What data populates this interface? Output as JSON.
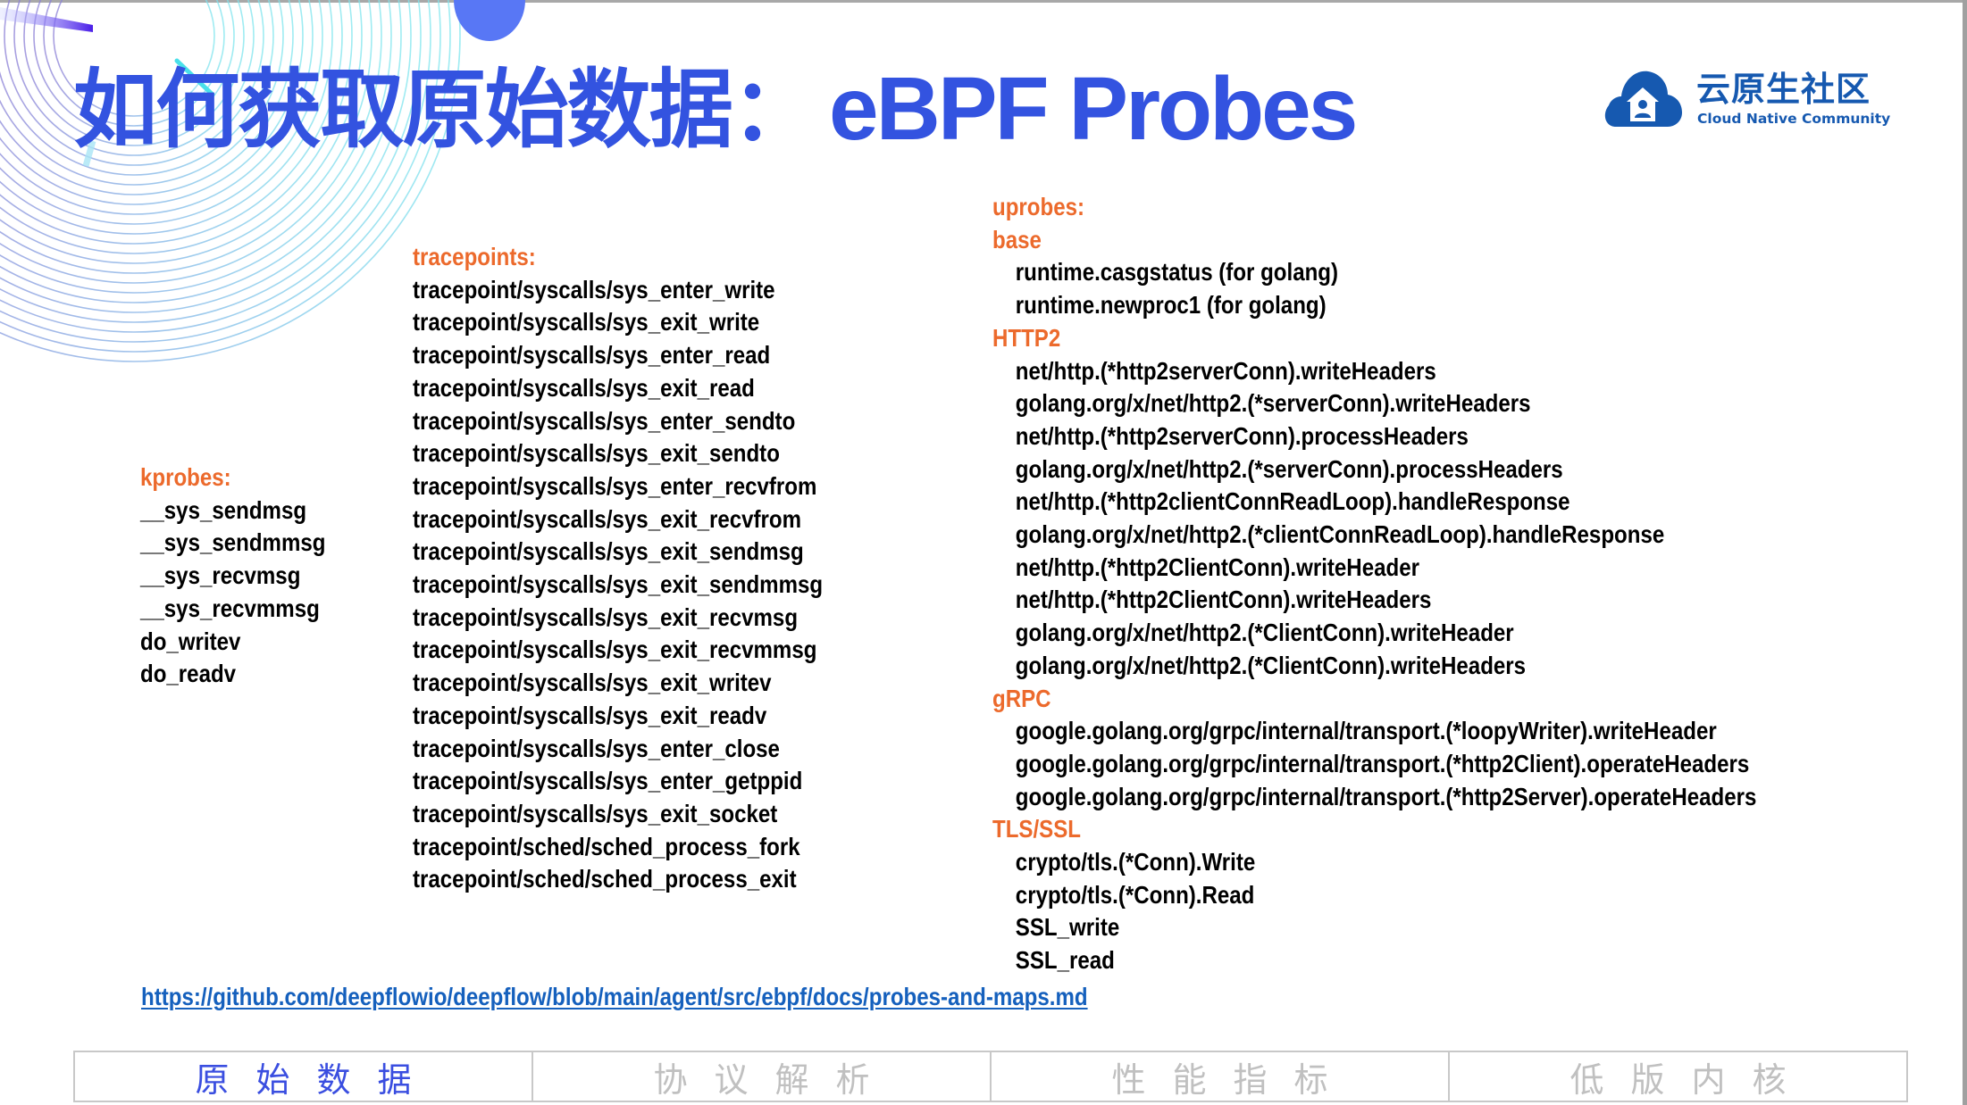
{
  "slide": {
    "title_cn": "如何获取原始数据：",
    "title_en": "eBPF Probes",
    "accent_color": "#3353e0",
    "header_color": "#ec6a2c"
  },
  "logo": {
    "name_cn": "云原生社区",
    "name_en": "Cloud Native Community",
    "icon": "cloud-house-icon",
    "color": "#1659b0"
  },
  "kprobes": {
    "header": "kprobes:",
    "items": [
      "__sys_sendmsg",
      "__sys_sendmmsg",
      "__sys_recvmsg",
      "__sys_recvmmsg",
      "do_writev",
      "do_readv"
    ]
  },
  "tracepoints": {
    "header": "tracepoints:",
    "items": [
      "tracepoint/syscalls/sys_enter_write",
      "tracepoint/syscalls/sys_exit_write",
      "tracepoint/syscalls/sys_enter_read",
      "tracepoint/syscalls/sys_exit_read",
      "tracepoint/syscalls/sys_enter_sendto",
      "tracepoint/syscalls/sys_exit_sendto",
      "tracepoint/syscalls/sys_enter_recvfrom",
      "tracepoint/syscalls/sys_exit_recvfrom",
      "tracepoint/syscalls/sys_exit_sendmsg",
      "tracepoint/syscalls/sys_exit_sendmmsg",
      "tracepoint/syscalls/sys_exit_recvmsg",
      "tracepoint/syscalls/sys_exit_recvmmsg",
      "tracepoint/syscalls/sys_exit_writev",
      "tracepoint/syscalls/sys_exit_readv",
      "tracepoint/syscalls/sys_enter_close",
      "tracepoint/syscalls/sys_enter_getppid",
      "tracepoint/syscalls/sys_exit_socket",
      "tracepoint/sched/sched_process_fork",
      "tracepoint/sched/sched_process_exit"
    ]
  },
  "uprobes": {
    "header": "uprobes:",
    "groups": [
      {
        "name": "base",
        "items": [
          "runtime.casgstatus (for golang)",
          "runtime.newproc1 (for golang)"
        ]
      },
      {
        "name": "HTTP2",
        "items": [
          "net/http.(*http2serverConn).writeHeaders",
          "golang.org/x/net/http2.(*serverConn).writeHeaders",
          "net/http.(*http2serverConn).processHeaders",
          "golang.org/x/net/http2.(*serverConn).processHeaders",
          "net/http.(*http2clientConnReadLoop).handleResponse",
          "golang.org/x/net/http2.(*clientConnReadLoop).handleResponse",
          "net/http.(*http2ClientConn).writeHeader",
          "net/http.(*http2ClientConn).writeHeaders",
          "golang.org/x/net/http2.(*ClientConn).writeHeader",
          "golang.org/x/net/http2.(*ClientConn).writeHeaders"
        ]
      },
      {
        "name": "gRPC",
        "items": [
          "google.golang.org/grpc/internal/transport.(*loopyWriter).writeHeader",
          "google.golang.org/grpc/internal/transport.(*http2Client).operateHeaders",
          "google.golang.org/grpc/internal/transport.(*http2Server).operateHeaders"
        ]
      },
      {
        "name": "TLS/SSL",
        "items": [
          "crypto/tls.(*Conn).Write",
          "crypto/tls.(*Conn).Read",
          "SSL_write",
          "SSL_read"
        ]
      }
    ]
  },
  "link": {
    "text": "https://github.com/deepflowio/deepflow/blob/main/agent/src/ebpf/docs/probes-and-maps.md",
    "color": "#1560bd"
  },
  "tabs": [
    {
      "label": "原始数据",
      "active": true
    },
    {
      "label": "协议解析",
      "active": false
    },
    {
      "label": "性能指标",
      "active": false
    },
    {
      "label": "低版内核",
      "active": false
    }
  ]
}
